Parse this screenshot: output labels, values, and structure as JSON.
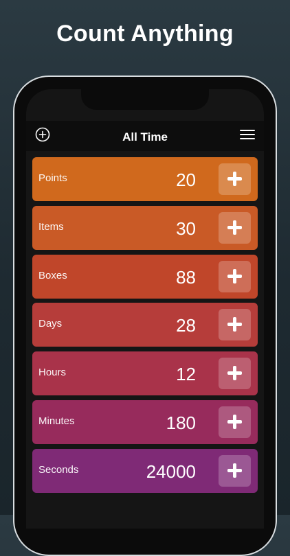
{
  "headline": "Count Anything",
  "navbar": {
    "title": "All Time",
    "left_icon": "add-circle-icon",
    "right_icon": "hamburger-menu-icon"
  },
  "counters": [
    {
      "label": "Points",
      "value": "20",
      "color": "#d0691d"
    },
    {
      "label": "Items",
      "value": "30",
      "color": "#c95a26"
    },
    {
      "label": "Boxes",
      "value": "88",
      "color": "#c0462a"
    },
    {
      "label": "Days",
      "value": "28",
      "color": "#b63d3a"
    },
    {
      "label": "Hours",
      "value": "12",
      "color": "#a9334a"
    },
    {
      "label": "Minutes",
      "value": "180",
      "color": "#972b5c"
    },
    {
      "label": "Seconds",
      "value": "24000",
      "color": "#7f2a76"
    }
  ],
  "increment_icon": "plus-icon"
}
